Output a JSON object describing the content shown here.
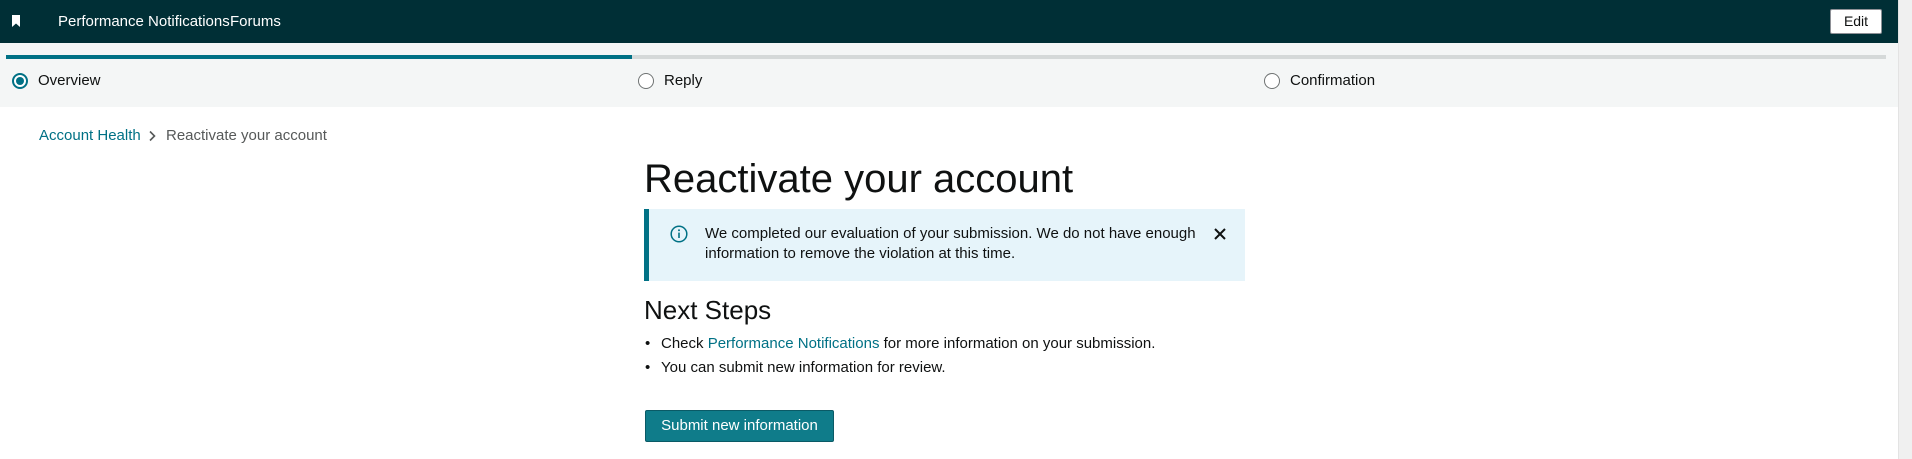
{
  "header": {
    "bookmark_icon": "bookmark-icon",
    "nav": [
      "Performance Notifications",
      "Forums"
    ],
    "edit_label": "Edit"
  },
  "stepper": {
    "progress_percent": 33.3,
    "accent_color": "#007185",
    "steps": [
      {
        "label": "Overview",
        "selected": true
      },
      {
        "label": "Reply",
        "selected": false
      },
      {
        "label": "Confirmation",
        "selected": false
      }
    ]
  },
  "breadcrumb": {
    "root": "Account Health",
    "separator_icon": "chevron-right-icon",
    "current": "Reactivate your account"
  },
  "main": {
    "title": "Reactivate your account",
    "alert": {
      "icon": "info-icon",
      "text": "We completed our evaluation of your submission. We do not have enough information to remove the violation at this time.",
      "close_icon": "close-icon"
    },
    "next_steps": {
      "heading": "Next Steps",
      "item1_prefix": "Check",
      "item1_link": "Performance Notifications",
      "item1_suffix": "for more information on your submission.",
      "item2": "You can submit new information for review."
    },
    "submit_label": "Submit new information"
  }
}
